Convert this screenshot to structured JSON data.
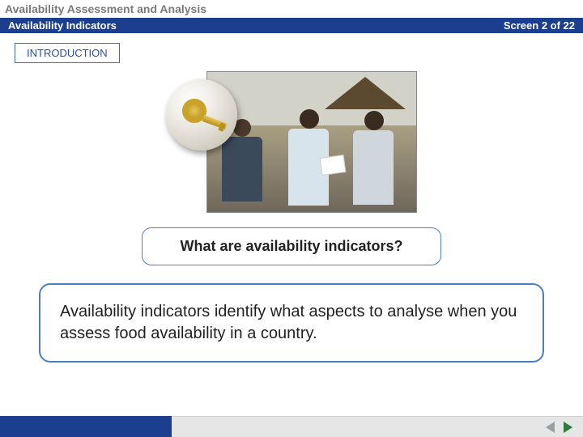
{
  "header": {
    "course_title": "Availability Assessment and Analysis",
    "module_title": "Availability Indicators",
    "screen_label": "Screen 2 of 22"
  },
  "section_label": "INTRODUCTION",
  "image": {
    "icon_name": "key-icon",
    "photo_alt": "People seated outdoors near a thatched hut, one writing on paper"
  },
  "question": "What are availability indicators?",
  "body_text": "Availability indicators identify what aspects to analyse when you assess food availability in a country.",
  "nav": {
    "prev": "Previous",
    "next": "Next"
  },
  "colors": {
    "header_bg": "#1b3e8f",
    "accent_border": "#4a7fc8",
    "prev_arrow": "#9aa0a6",
    "next_arrow": "#2a7a3a"
  }
}
